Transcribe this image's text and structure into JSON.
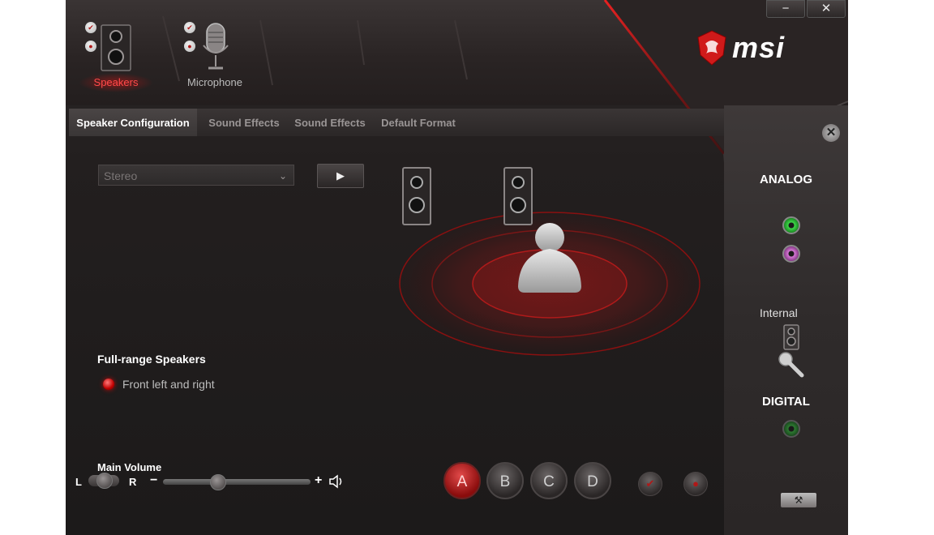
{
  "window": {
    "minimize_icon": "−",
    "close_icon": "✕"
  },
  "brand": {
    "name": "msi",
    "color": "#ffffff",
    "accent": "#d01a1a"
  },
  "devices": [
    {
      "label": "Speakers",
      "active": true
    },
    {
      "label": "Microphone",
      "active": false
    }
  ],
  "tabs": [
    {
      "label": "Speaker Configuration",
      "active": true
    },
    {
      "label": "Sound Effects",
      "active": false
    },
    {
      "label": "Sound Effects",
      "active": false
    },
    {
      "label": "Default Format",
      "active": false
    }
  ],
  "config": {
    "selected": "Stereo",
    "play_icon": "▶"
  },
  "full_range": {
    "title": "Full-range Speakers",
    "option": "Front left and right"
  },
  "volume": {
    "title": "Main Volume",
    "left": "L",
    "right": "R",
    "minus": "−",
    "plus": "+",
    "level": 0.37,
    "balance": 0.5
  },
  "profiles": [
    "A",
    "B",
    "C",
    "D"
  ],
  "active_profile": "A",
  "panel": {
    "analog": "ANALOG",
    "internal": "Internal",
    "digital": "DIGITAL"
  },
  "colors": {
    "accent_red": "#d01a1a",
    "jack_green": "#3fd84a",
    "jack_pink": "#d67ad6"
  }
}
